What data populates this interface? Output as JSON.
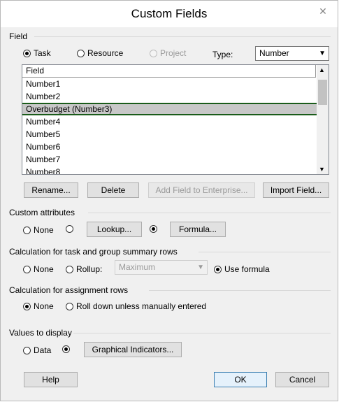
{
  "dialog": {
    "title": "Custom Fields",
    "close_glyph": "✕"
  },
  "field_section": {
    "label": "Field",
    "radios": {
      "task": "Task",
      "resource": "Resource",
      "project": "Project"
    },
    "type_label": "Type:",
    "type_value": "Number"
  },
  "field_list": {
    "header": "Field",
    "rows": [
      "Number1",
      "Number2",
      "Overbudget (Number3)",
      "Number4",
      "Number5",
      "Number6",
      "Number7",
      "Number8"
    ],
    "selected_index": 2
  },
  "buttons": {
    "rename": "Rename...",
    "delete": "Delete",
    "add_to_enterprise": "Add Field to Enterprise...",
    "import_field": "Import Field...",
    "lookup": "Lookup...",
    "formula": "Formula...",
    "graphical_indicators": "Graphical Indicators...",
    "help": "Help",
    "ok": "OK",
    "cancel": "Cancel"
  },
  "custom_attributes": {
    "label": "Custom attributes",
    "none": "None"
  },
  "calc_summary": {
    "label": "Calculation for task and group summary rows",
    "none": "None",
    "rollup": "Rollup:",
    "rollup_value": "Maximum",
    "use_formula": "Use formula"
  },
  "calc_assignment": {
    "label": "Calculation for assignment rows",
    "none": "None",
    "roll_down": "Roll down unless manually entered"
  },
  "values_display": {
    "label": "Values to display",
    "data": "Data"
  }
}
